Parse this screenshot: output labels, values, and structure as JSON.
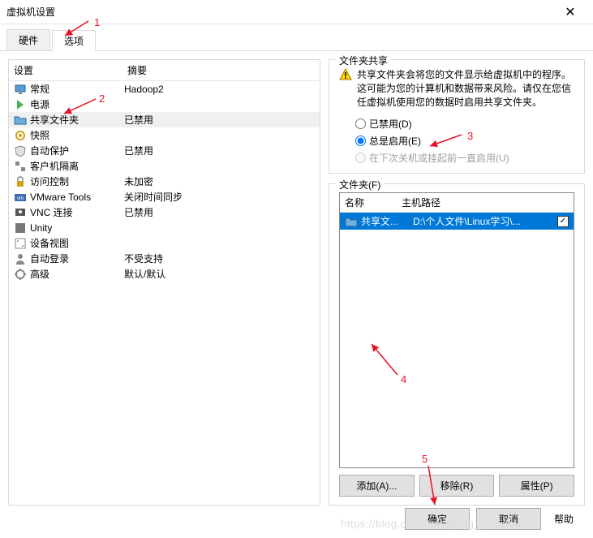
{
  "window": {
    "title": "虚拟机设置",
    "close": "✕"
  },
  "tabs": {
    "hardware": "硬件",
    "options": "选项"
  },
  "list": {
    "header_setting": "设置",
    "header_summary": "摘要",
    "rows": [
      {
        "name": "常规",
        "summary": "Hadoop2",
        "icon": "monitor"
      },
      {
        "name": "电源",
        "summary": "",
        "icon": "power"
      },
      {
        "name": "共享文件夹",
        "summary": "已禁用",
        "icon": "folder-share",
        "highlighted": true
      },
      {
        "name": "快照",
        "summary": "",
        "icon": "snapshot"
      },
      {
        "name": "自动保护",
        "summary": "已禁用",
        "icon": "shield"
      },
      {
        "name": "客户机隔离",
        "summary": "",
        "icon": "isolation"
      },
      {
        "name": "访问控制",
        "summary": "未加密",
        "icon": "lock"
      },
      {
        "name": "VMware Tools",
        "summary": "关闭时间同步",
        "icon": "vmware"
      },
      {
        "name": "VNC 连接",
        "summary": "已禁用",
        "icon": "vnc"
      },
      {
        "name": "Unity",
        "summary": "",
        "icon": "unity"
      },
      {
        "name": "设备视图",
        "summary": "",
        "icon": "device"
      },
      {
        "name": "自动登录",
        "summary": "不受支持",
        "icon": "login"
      },
      {
        "name": "高级",
        "summary": "默认/默认",
        "icon": "advanced"
      }
    ]
  },
  "sharing": {
    "group_title": "文件夹共享",
    "warning": "共享文件夹会将您的文件显示给虚拟机中的程序。这可能为您的计算机和数据带来风险。请仅在您信任虚拟机使用您的数据时启用共享文件夹。",
    "radio_disabled": "已禁用(D)",
    "radio_always": "总是启用(E)",
    "radio_next": "在下次关机或挂起前一直启用(U)"
  },
  "folders": {
    "group_title": "文件夹(F)",
    "header_name": "名称",
    "header_path": "主机路径",
    "row_name": "共享文...",
    "row_path": "D:\\个人文件\\Linux学习\\...",
    "btn_add": "添加(A)...",
    "btn_remove": "移除(R)",
    "btn_props": "属性(P)"
  },
  "footer": {
    "ok": "确定",
    "cancel": "取消",
    "help": "帮助"
  },
  "annotations": {
    "n1": "1",
    "n2": "2",
    "n3": "3",
    "n4": "4",
    "n5": "5"
  },
  "watermark": "https://blog.csdn.net/flying_hadelele1"
}
